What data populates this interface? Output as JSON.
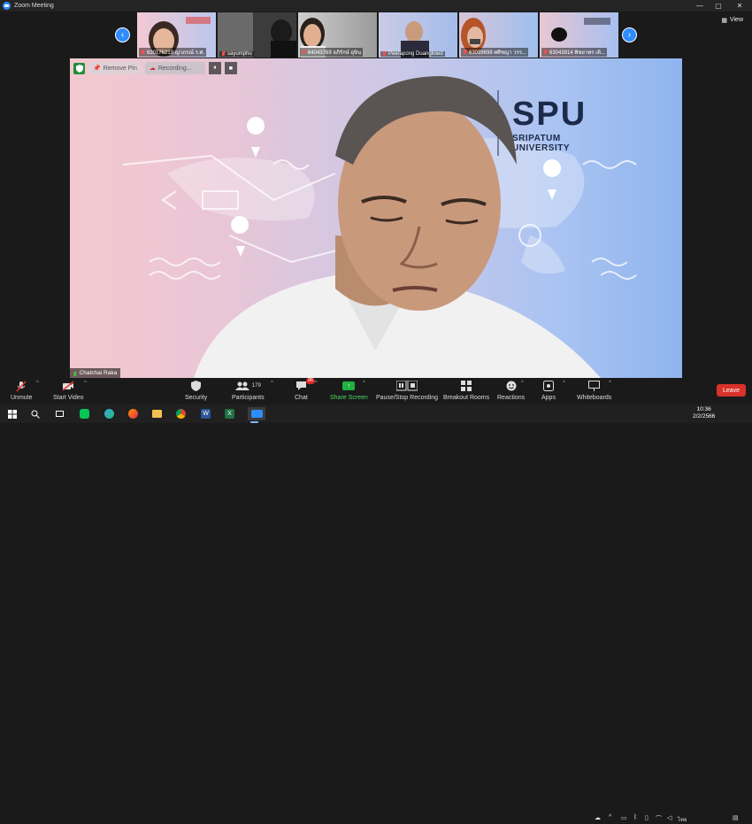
{
  "window": {
    "title": "Zoom Meeting",
    "minimize": "—",
    "maximize": "▢",
    "close": "✕"
  },
  "gallery": {
    "view_label": "View",
    "prev": "‹",
    "next": "›",
    "tiles": [
      {
        "name": "630176219 ญาภรณ์ ร.ศ."
      },
      {
        "name": "sayumphu"
      },
      {
        "name": "64043769 อภิรักษ์ อุษิน"
      },
      {
        "name": "Peerapong Duangkoed"
      },
      {
        "name": "63039698 ศศิชญา วรร..."
      },
      {
        "name": "63043914 พิชยาพร เติ..."
      }
    ]
  },
  "pin_bar": {
    "remove_pin": "Remove Pin",
    "recording": "Recording...",
    "pause": "⏸",
    "stop": "■"
  },
  "main_video": {
    "brand": "SPU",
    "brand_sub_1": "SRIPATUM",
    "brand_sub_2": "UNIVERSITY",
    "speaker": "Chatchai Raka"
  },
  "toolbar": {
    "unmute": "Unmute",
    "start_video": "Start Video",
    "security": "Security",
    "participants": "Participants",
    "participants_count": "179",
    "chat": "Chat",
    "chat_badge": "96",
    "share_screen": "Share Screen",
    "pause_stop_recording": "Pause/Stop Recording",
    "breakout_rooms": "Breakout Rooms",
    "reactions": "Reactions",
    "apps": "Apps",
    "whiteboards": "Whiteboards",
    "leave": "Leave"
  },
  "taskbar": {
    "time": "10:36",
    "date": "2/2/2566",
    "lang": "ไทย"
  },
  "colors": {
    "zoom_blue": "#2D8CFF",
    "leave_red": "#d9312b",
    "share_green": "#1fb141"
  }
}
